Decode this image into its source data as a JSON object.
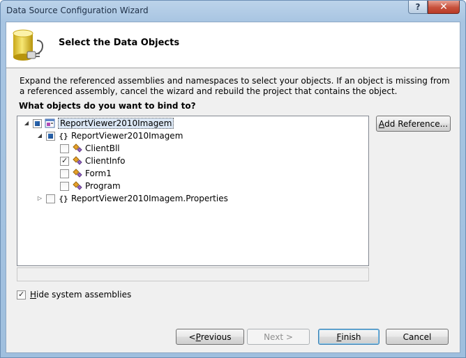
{
  "window": {
    "title": "Data Source Configuration Wizard",
    "help_label": "?",
    "close_label": "✕"
  },
  "header": {
    "title": "Select the Data Objects",
    "icon": "database-plug-icon"
  },
  "description": "Expand the referenced assemblies and namespaces to select your objects. If an object is missing from a referenced assembly, cancel the wizard and rebuild the project that contains the object.",
  "question": "What objects do you want to bind to?",
  "tree": {
    "root": {
      "label": "ReportViewer2010Imagem",
      "state": "partial",
      "expanded": true
    },
    "namespace": {
      "label": "ReportViewer2010Imagem",
      "icon_text": "{}",
      "state": "partial",
      "expanded": true
    },
    "classes": [
      {
        "label": "ClientBll",
        "checked": false
      },
      {
        "label": "ClientInfo",
        "checked": true
      },
      {
        "label": "Form1",
        "checked": false
      },
      {
        "label": "Program",
        "checked": false
      }
    ],
    "properties_ns": {
      "label": "ReportViewer2010Imagem.Properties",
      "icon_text": "{}",
      "checked": false,
      "expanded": false
    }
  },
  "add_reference": {
    "prefix": "",
    "hotkey": "A",
    "rest": "dd Reference..."
  },
  "hide_system": {
    "hotkey": "H",
    "rest": "ide system assemblies",
    "checked": true
  },
  "buttons": {
    "previous": {
      "prefix": "< ",
      "hotkey": "P",
      "rest": "revious"
    },
    "next": {
      "label": "Next >"
    },
    "finish": {
      "hotkey": "F",
      "rest": "inish"
    },
    "cancel": {
      "label": "Cancel"
    }
  },
  "colors": {
    "title_gradient": "#a8c5e2",
    "close_button": "#c7503b",
    "selection": "#dbe7f5"
  }
}
